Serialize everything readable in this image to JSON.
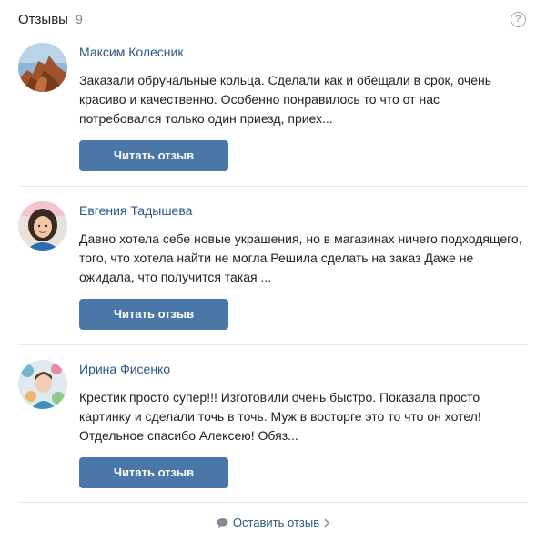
{
  "header": {
    "title": "Отзывы",
    "count": "9",
    "help_glyph": "?"
  },
  "reviews": [
    {
      "name": "Максим Колесник",
      "text": "Заказали обручальные кольца. Сделали как и обещали в срок, очень красиво и качественно. Особенно понравилось то что от нас потребовался только один приезд, приех...",
      "button_label": "Читать отзыв",
      "avatar_icon": "avatar-photo-rock-landscape"
    },
    {
      "name": "Евгения Тадышева",
      "text": "Давно хотела себе новые украшения, но в магазинах ничего подходящего, того, что хотела найти не могла Решила сделать на заказ Даже не ожидала, что получится такая ...",
      "button_label": "Читать отзыв",
      "avatar_icon": "avatar-photo-woman"
    },
    {
      "name": "Ирина Фисенко",
      "text": "Крестик просто супер!!! Изготовили очень быстро. Показала просто картинку и сделали точь в точь. Муж в восторге это то что он хотел! Отдельное спасибо Алексею! Обяз...",
      "button_label": "Читать отзыв",
      "avatar_icon": "avatar-photo-floral"
    }
  ],
  "footer": {
    "leave_review_label": "Оставить отзыв",
    "icons": [
      "comment-icon",
      "chevron-right-icon"
    ]
  },
  "colors": {
    "link": "#2a5885",
    "button": "#4a76a8",
    "divider": "#e7e8ec",
    "muted": "#828282"
  }
}
